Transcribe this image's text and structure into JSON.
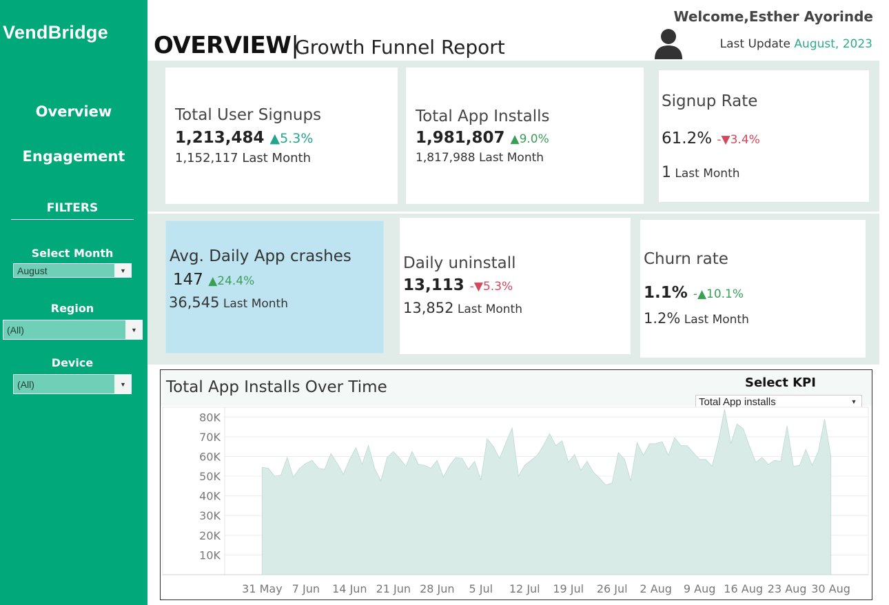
{
  "sidebar": {
    "brand": "VendBridge",
    "nav": [
      "Overview",
      "Engagement"
    ],
    "filters_title": "FILTERS",
    "filters": [
      {
        "label": "Select Month",
        "value": "August"
      },
      {
        "label": "Region",
        "value": "(All)"
      },
      {
        "label": "Device",
        "value": "(All)"
      }
    ]
  },
  "header": {
    "title": "OVERVIEW",
    "separator": "|",
    "subtitle": "Growth Funnel Report",
    "welcome_prefix": "Welcome,",
    "user_name": "Esther Ayorinde",
    "update_label": "Last Update",
    "update_date": "August, 2023",
    "avatar_icon": "user-avatar-icon"
  },
  "kpis": [
    {
      "title": "Total User Signups",
      "value": "1,213,484",
      "change": "▲5.3%",
      "prev_value": "1,152,117",
      "prev_label": "Last Month"
    },
    {
      "title": "Total App Installs",
      "value": "1,981,807",
      "change": "▲9.0%",
      "prev_value": "1,817,988",
      "prev_label": "Last Month"
    },
    {
      "title": "Signup Rate",
      "value": "61.2%",
      "change": "-▼3.4%",
      "prev_value": "1",
      "prev_label": "Last Month"
    },
    {
      "title": "Avg. Daily App crashes",
      "value": "147",
      "change": "▲24.4%",
      "prev_value": "36,545",
      "prev_label": "Last Month"
    },
    {
      "title": "Daily uninstall",
      "value": "13,113",
      "change": "-▼5.3%",
      "prev_value": "13,852",
      "prev_label": "Last Month"
    },
    {
      "title": "Churn rate",
      "value": "1.1%",
      "change": "-▲10.1%",
      "prev_value": "1.2%",
      "prev_label": "Last Month"
    }
  ],
  "colors": {
    "sidebar": "#00a87a",
    "accent": "#2fa98a",
    "up": "#3a9e57",
    "down": "#d3485a",
    "area_fill": "#d9ebe6",
    "area_line": "#c3ddd6",
    "highlight_card": "#bee4f1"
  },
  "chart": {
    "title": "Total App Installs Over Time",
    "kpi_label": "Select KPI",
    "kpi_value": "Total App installs"
  },
  "chart_data": {
    "type": "area",
    "title": "Total App Installs Over Time",
    "xlabel": "",
    "ylabel": "",
    "ylim": [
      0,
      85000
    ],
    "y_ticks": [
      "10K",
      "20K",
      "30K",
      "40K",
      "50K",
      "60K",
      "70K",
      "80K"
    ],
    "x_tick_labels": [
      "31 May",
      "7 Jun",
      "14 Jun",
      "21 Jun",
      "28 Jun",
      "5 Jul",
      "12 Jul",
      "19 Jul",
      "26 Jul",
      "2 Aug",
      "9 Aug",
      "16 Aug",
      "23 Aug",
      "30 Aug"
    ],
    "x_start": "2023-05-31",
    "x_end": "2023-08-31",
    "grid": true,
    "series": [
      {
        "values": [
          54500,
          54000,
          50000,
          50500,
          59500,
          49500,
          54000,
          56500,
          58000,
          54000,
          53500,
          61500,
          56500,
          51000,
          58500,
          64500,
          56000,
          65500,
          54000,
          47500,
          59500,
          62500,
          59000,
          55000,
          62500,
          56000,
          55500,
          54000,
          58000,
          49500,
          55500,
          59500,
          59000,
          53500,
          57500,
          48000,
          69000,
          65000,
          59000,
          67000,
          74500,
          50000,
          55500,
          58000,
          60500,
          65500,
          71500,
          65500,
          68000,
          57000,
          61000,
          53000,
          57500,
          52000,
          49000,
          45500,
          46500,
          62000,
          58500,
          47500,
          67000,
          60500,
          66500,
          66500,
          67500,
          60500,
          69500,
          65500,
          65500,
          62000,
          58500,
          58500,
          55000,
          67500,
          84000,
          66500,
          76500,
          74000,
          65000,
          57000,
          59500,
          56000,
          58000,
          57500,
          75500,
          55000,
          55500,
          63500,
          55500,
          62500,
          79000,
          60000
        ]
      }
    ]
  }
}
